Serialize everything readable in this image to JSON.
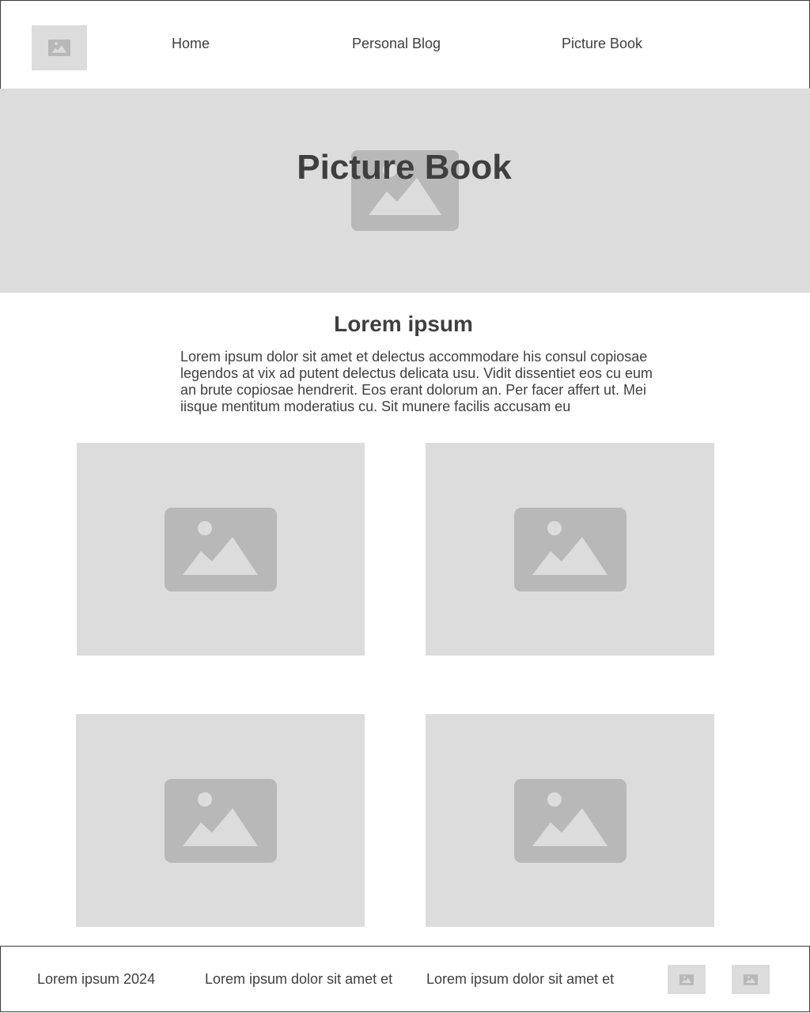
{
  "header": {
    "logo_icon": "image-placeholder-icon",
    "nav": [
      {
        "label": "Home"
      },
      {
        "label": "Personal Blog"
      },
      {
        "label": "Picture Book"
      }
    ]
  },
  "hero": {
    "title": "Picture Book",
    "icon": "image-placeholder-icon"
  },
  "intro": {
    "title": "Lorem ipsum",
    "text": "Lorem ipsum dolor sit amet et delectus accommodare his consul copiosae legendos at vix ad putent delectus delicata usu. Vidit dissentiet eos cu eum an brute copiosae hendrerit. Eos erant dolorum an. Per facer affert ut. Mei iisque mentitum moderatius cu. Sit munere facilis accusam eu"
  },
  "gallery": {
    "icon": "image-placeholder-icon",
    "count": 4
  },
  "footer": {
    "texts": [
      {
        "text": "Lorem ipsum 2024"
      },
      {
        "text": "Lorem ipsum dolor sit amet et"
      },
      {
        "text": "Lorem ipsum dolor sit amet et"
      }
    ],
    "social_icons": [
      "image-placeholder-icon",
      "image-placeholder-icon"
    ]
  },
  "colors": {
    "placeholder_bg": "#dcdcdc",
    "placeholder_icon": "#b8b8b8",
    "text": "#3f3f3f",
    "border": "#3a3a3a"
  }
}
